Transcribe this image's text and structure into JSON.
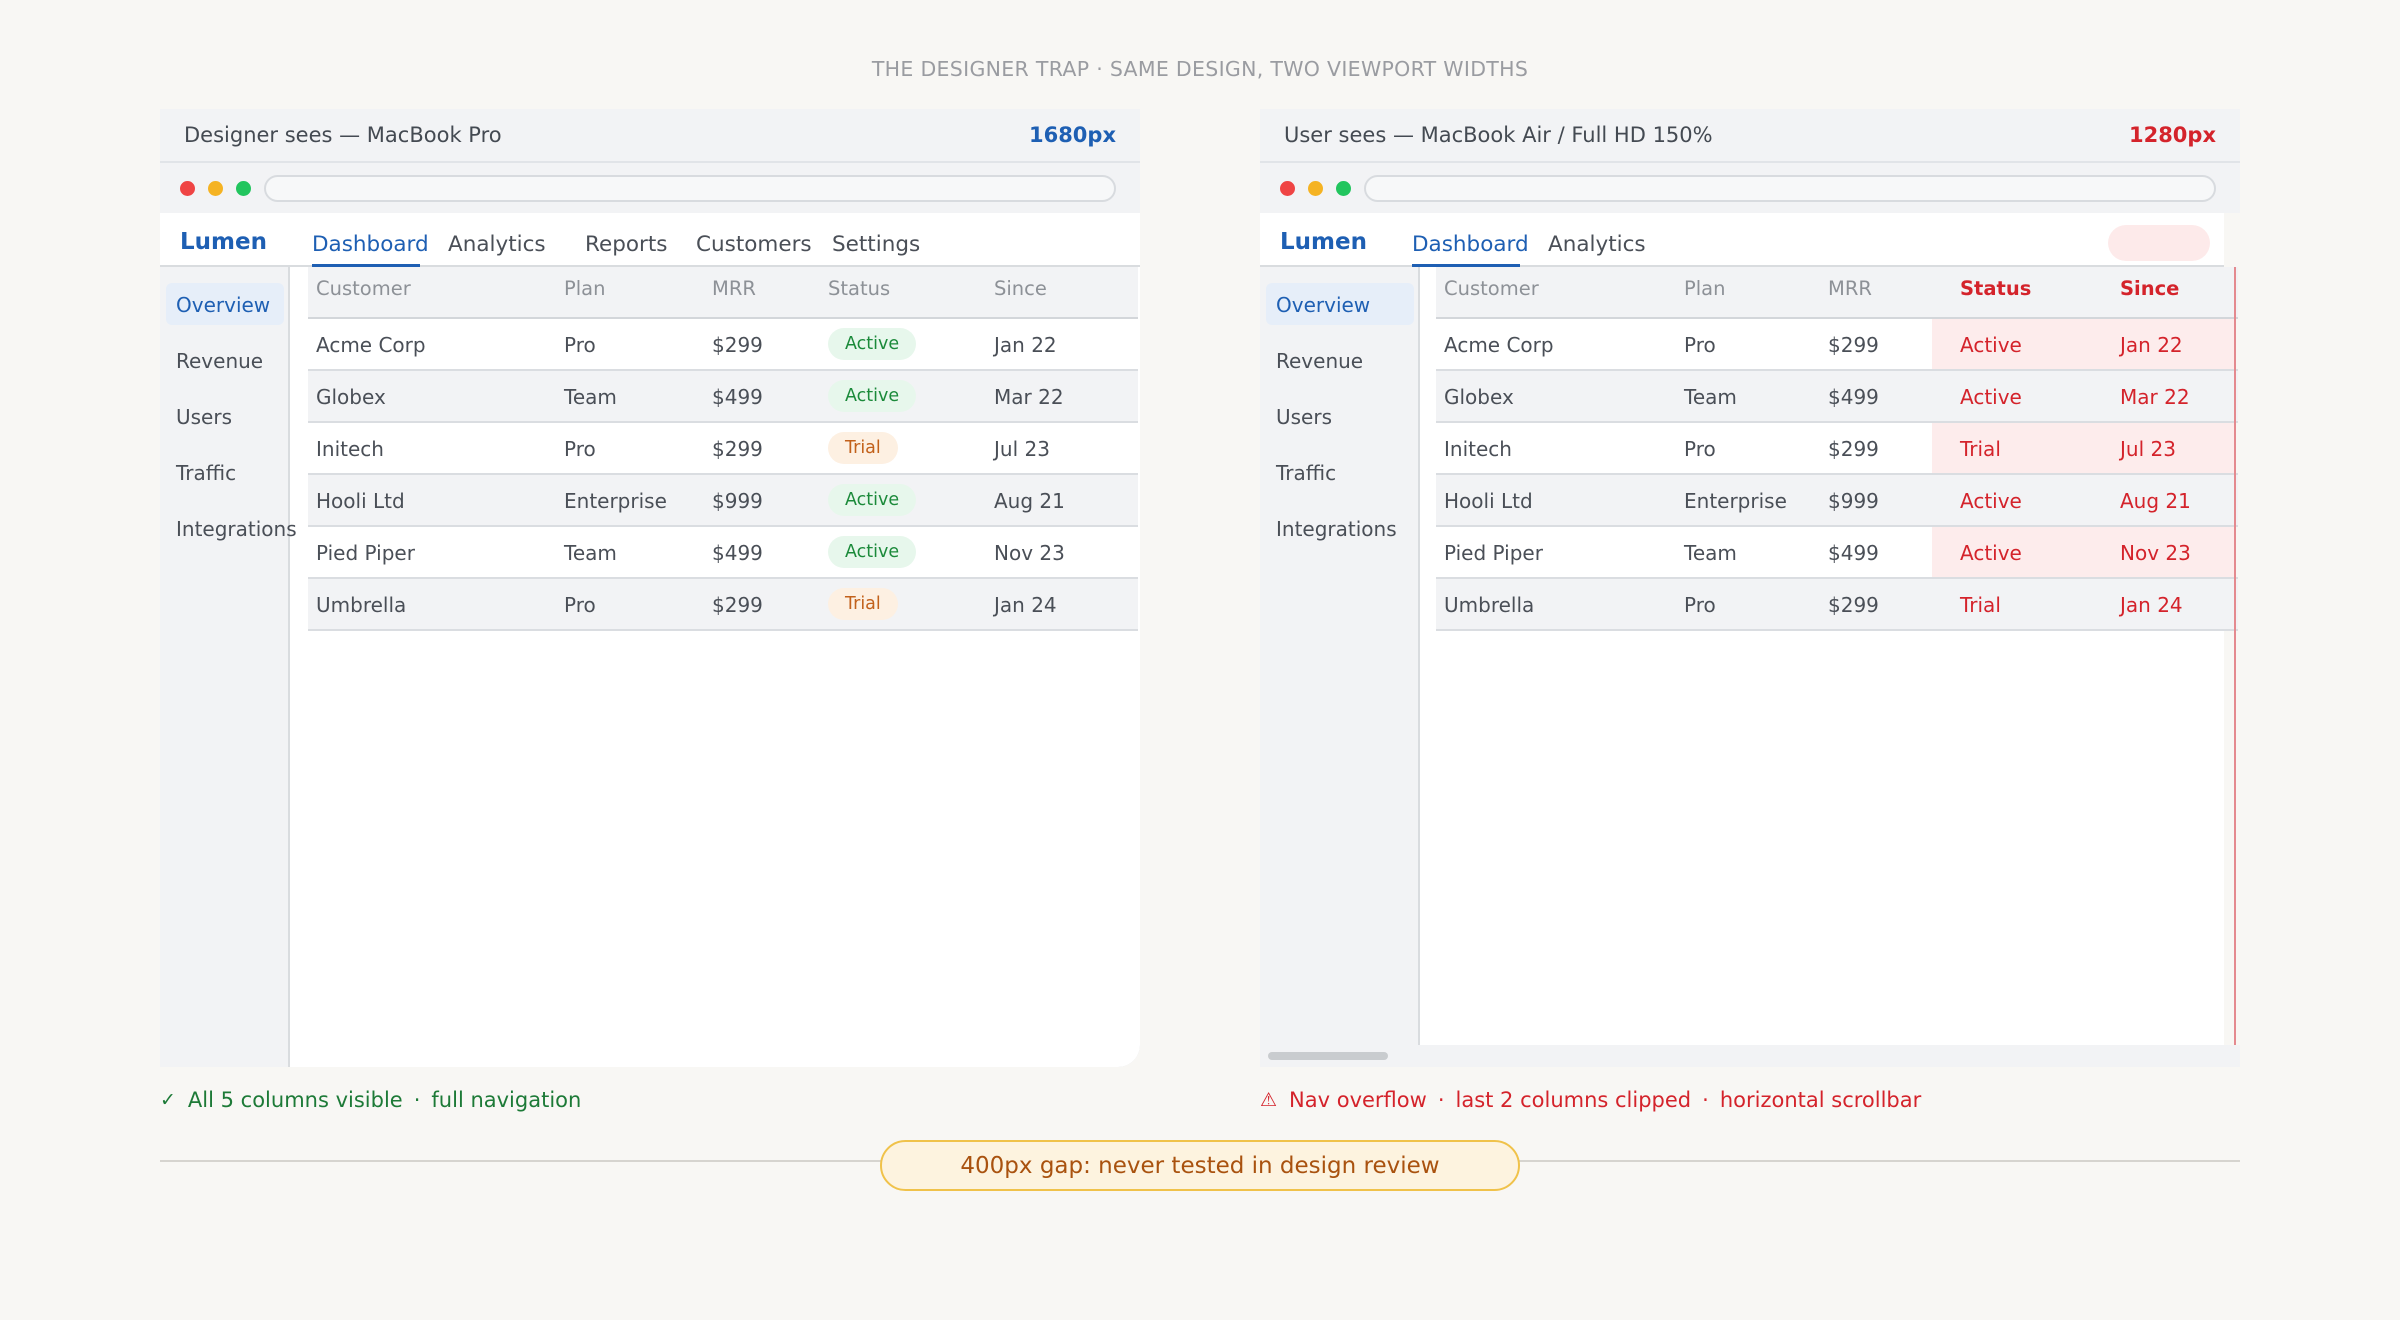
{
  "title": "THE DESIGNER TRAP  ·  SAME DESIGN, TWO VIEWPORT WIDTHS",
  "left": {
    "header": "Designer sees — MacBook Pro",
    "width_label": "1680px",
    "brand": "Lumen",
    "tabs": [
      "Dashboard",
      "Analytics",
      "Reports",
      "Customers",
      "Settings"
    ],
    "sidebar": [
      "Overview",
      "Revenue",
      "Users",
      "Traffic",
      "Integrations"
    ],
    "caption": {
      "check": "✓",
      "a": "All 5 columns visible",
      "sep": "·",
      "b": "full navigation"
    }
  },
  "right": {
    "header": "User sees — MacBook Air / Full HD 150%",
    "width_label": "1280px",
    "brand": "Lumen",
    "tabs": [
      "Dashboard",
      "Analytics"
    ],
    "sidebar": [
      "Overview",
      "Revenue",
      "Users",
      "Traffic",
      "Integrations"
    ],
    "caption": {
      "warn": "⚠",
      "a": "Nav overflow",
      "sep": "·",
      "b": "last 2 columns clipped",
      "c": "horizontal scrollbar"
    }
  },
  "table": {
    "columns": [
      "Customer",
      "Plan",
      "MRR",
      "Status",
      "Since"
    ],
    "rows": [
      [
        "Acme Corp",
        "Pro",
        "$299",
        "Active",
        "Jan 22"
      ],
      [
        "Globex",
        "Team",
        "$499",
        "Active",
        "Mar 22"
      ],
      [
        "Initech",
        "Pro",
        "$299",
        "Trial",
        "Jul 23"
      ],
      [
        "Hooli Ltd",
        "Enterprise",
        "$999",
        "Active",
        "Aug 21"
      ],
      [
        "Pied Piper",
        "Team",
        "$499",
        "Active",
        "Nov 23"
      ],
      [
        "Umbrella",
        "Pro",
        "$299",
        "Trial",
        "Jan 24"
      ]
    ]
  },
  "gap_label": "400px gap: never tested in design review",
  "colors": {
    "accent": "#1e5fb3",
    "danger": "#d4232b",
    "success": "#1b8a3a",
    "warning": "#c2611b"
  }
}
